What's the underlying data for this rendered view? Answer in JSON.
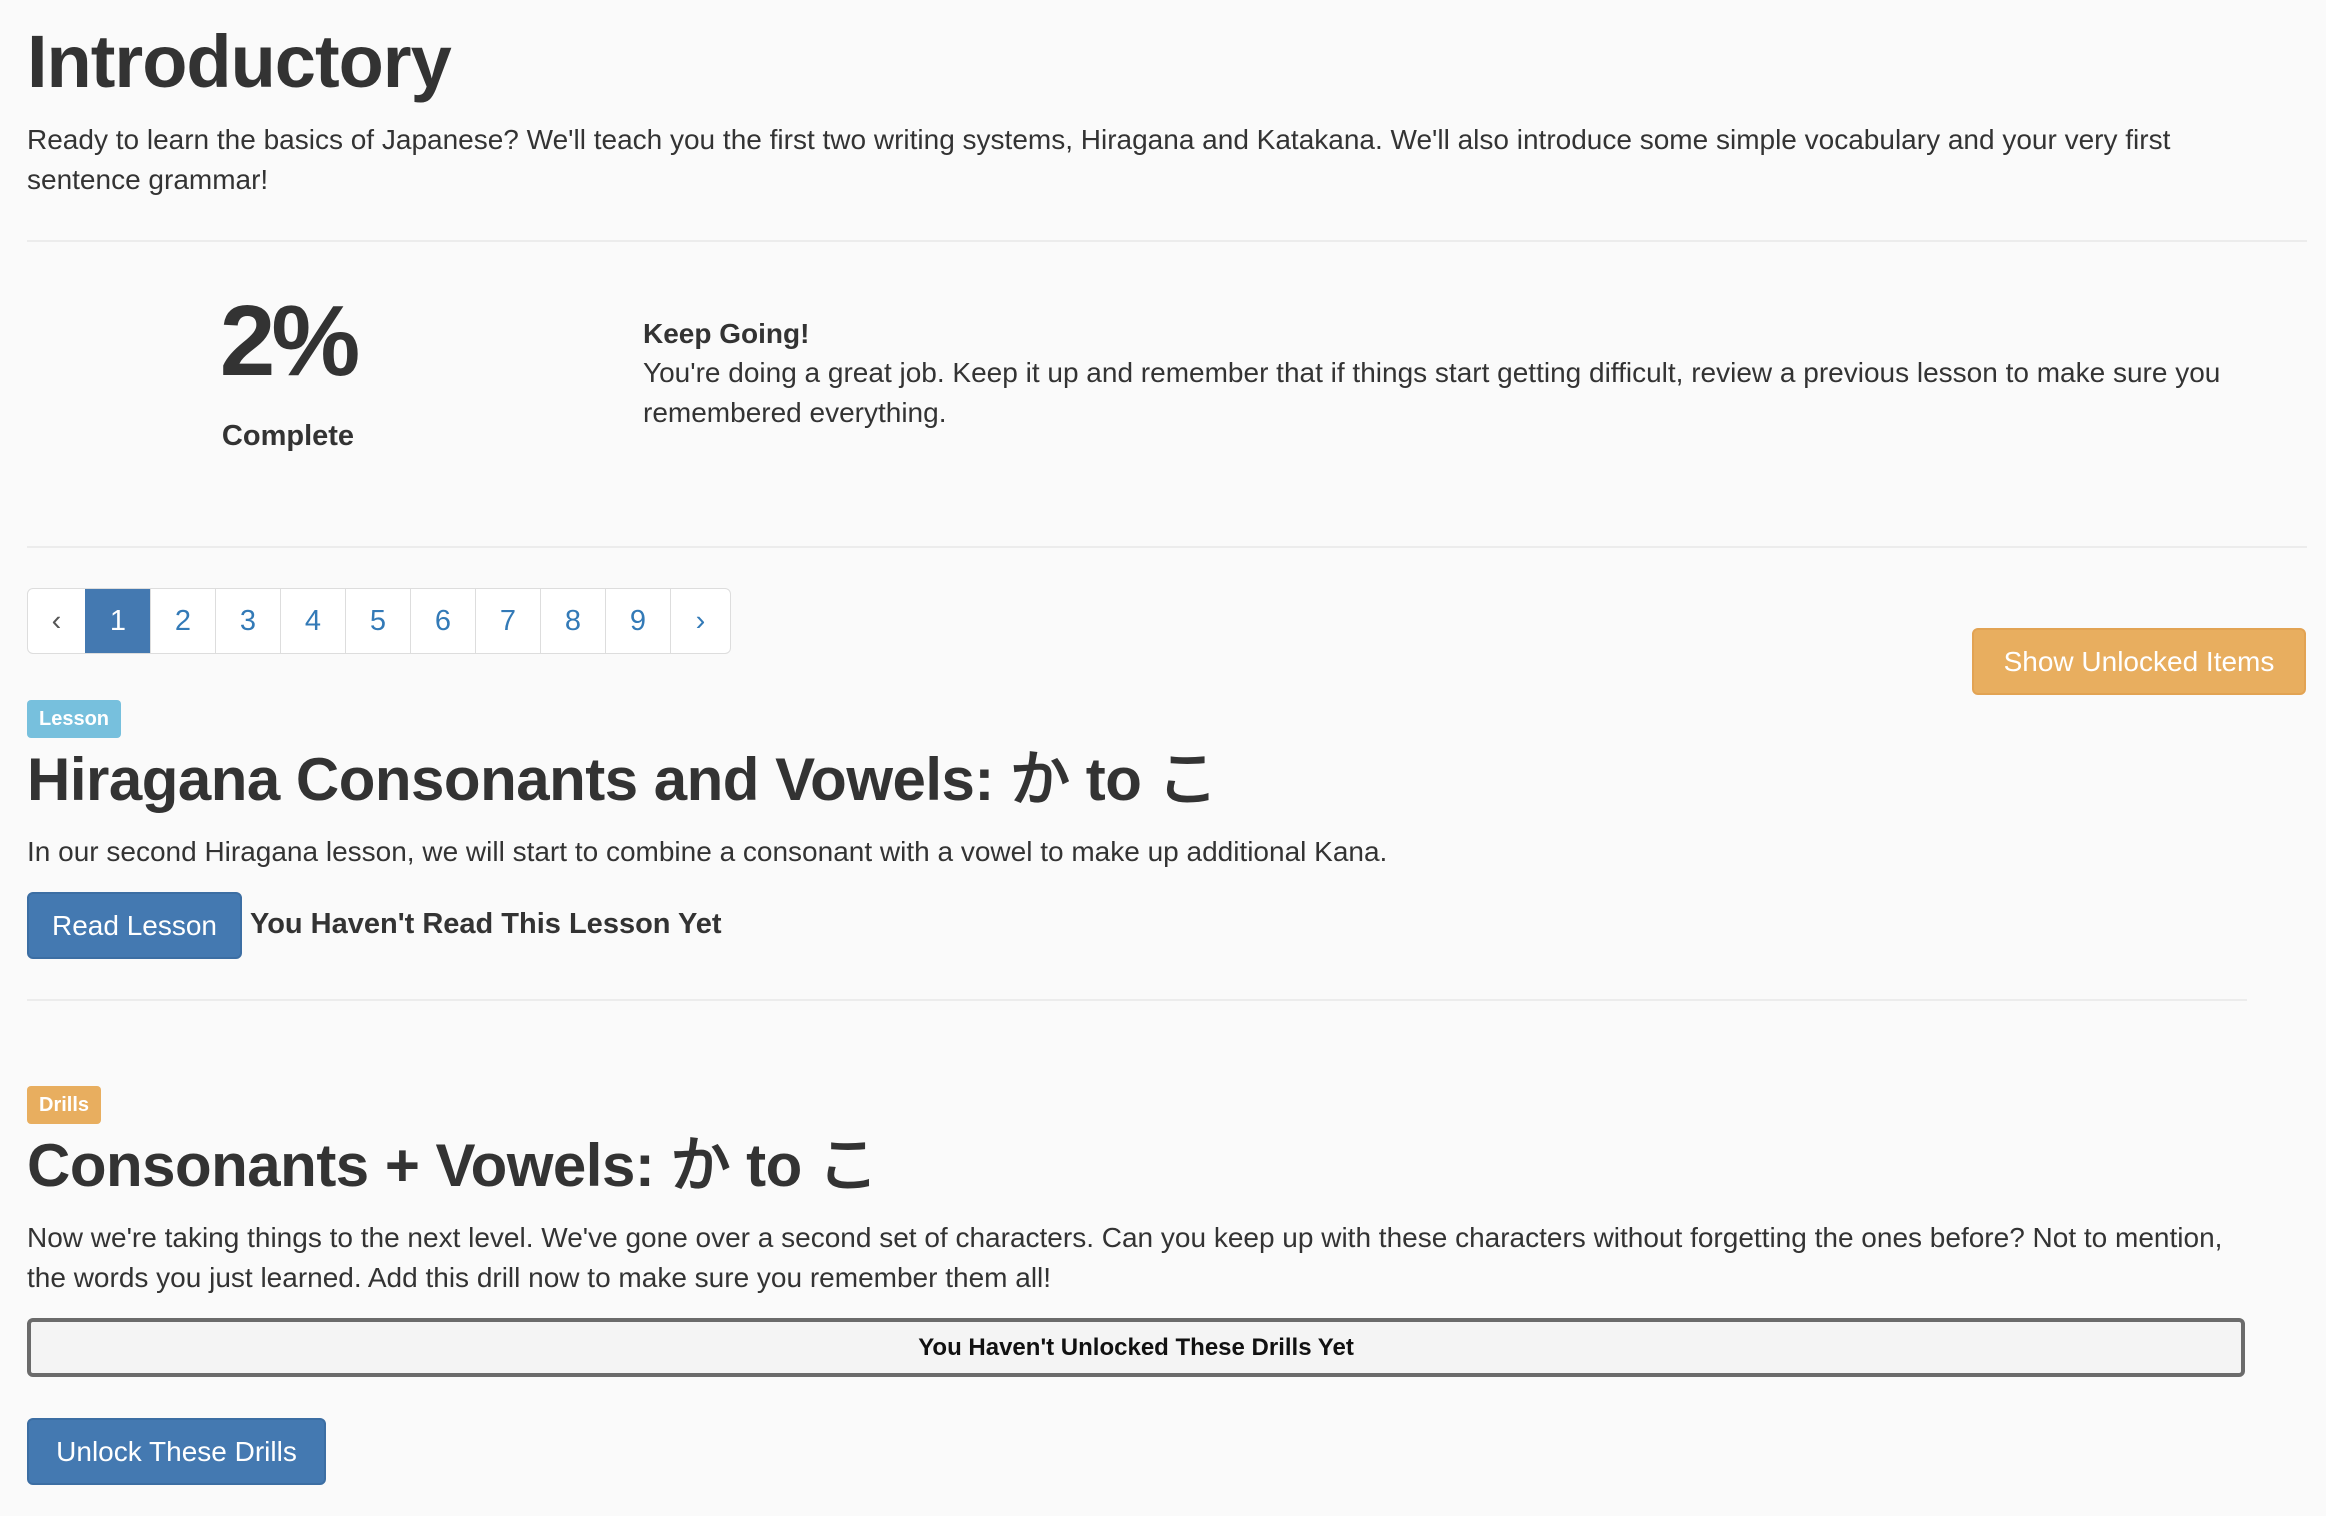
{
  "header": {
    "title": "Introductory",
    "intro": "Ready to learn the basics of Japanese? We'll teach you the first two writing systems, Hiragana and Katakana. We'll also introduce some simple vocabulary and your very first sentence grammar!"
  },
  "progress": {
    "percent_label": "2%",
    "percent_value": 2,
    "complete_label": "Complete",
    "encourage_title": "Keep Going!",
    "encourage_body": "You're doing a great job. Keep it up and remember that if things start getting difficult, review a previous lesson to make sure you remembered everything."
  },
  "pagination": {
    "prev": "‹",
    "pages": [
      "1",
      "2",
      "3",
      "4",
      "5",
      "6",
      "7",
      "8",
      "9"
    ],
    "active_page": "1",
    "next": "›"
  },
  "toolbar": {
    "show_unlocked_label": "Show Unlocked Items"
  },
  "lesson": {
    "badge": "Lesson",
    "title": "Hiragana Consonants and Vowels: か to こ",
    "description": "In our second Hiragana lesson, we will start to combine a consonant with a vowel to make up additional Kana.",
    "button_label": "Read Lesson",
    "status": "You Haven't Read This Lesson Yet"
  },
  "drills": {
    "badge": "Drills",
    "title": "Consonants + Vowels: か to こ",
    "description": "Now we're taking things to the next level. We've gone over a second set of characters. Can you keep up with these characters without forgetting the ones before? Not to mention, the words you just learned. Add this drill now to make sure you remember them all!",
    "locked_message": "You Haven't Unlocked These Drills Yet",
    "button_label": "Unlock These Drills"
  },
  "colors": {
    "primary": "#4479b1",
    "warning": "#e8ae5f",
    "info": "#77c0dd",
    "text": "#333333",
    "background": "#fafafa"
  }
}
